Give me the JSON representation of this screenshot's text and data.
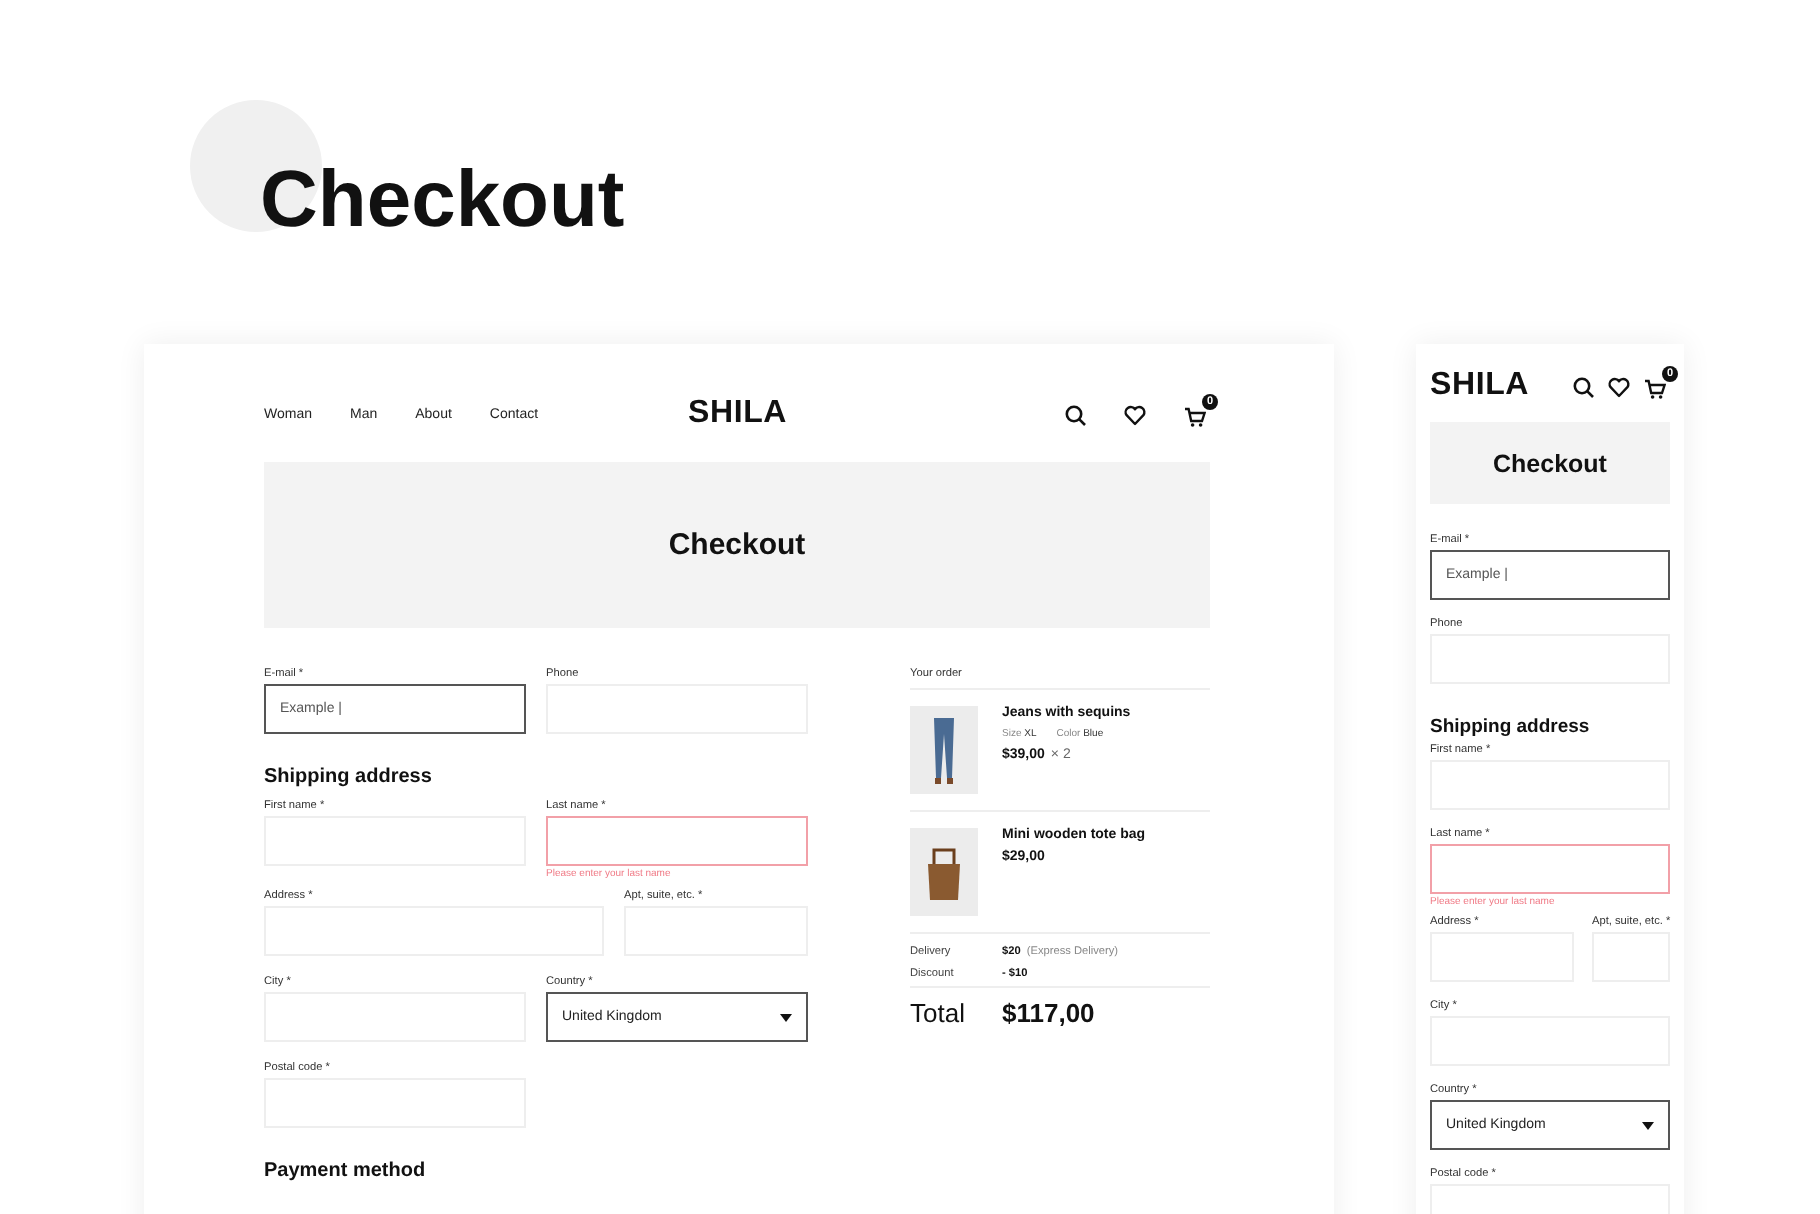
{
  "page_title": "Checkout",
  "desktop": {
    "nav": [
      "Woman",
      "Man",
      "About",
      "Contact"
    ],
    "logo": "SHILA",
    "cart_count": "0",
    "banner": "Checkout",
    "form": [
      {
        "kind": "pair",
        "fields": [
          {
            "label": "E-mail *",
            "value": "Example |",
            "kind": "text",
            "focused": true,
            "invalid": false
          },
          {
            "label": "Phone",
            "kind": "text",
            "focused": false,
            "invalid": false
          }
        ]
      },
      {
        "kind": "heading",
        "text": "Shipping address"
      },
      {
        "kind": "pair",
        "fields": [
          {
            "label": "First name *",
            "kind": "text",
            "focused": false,
            "invalid": false
          },
          {
            "label": "Last name *",
            "kind": "text",
            "focused": false,
            "invalid": true,
            "error": "Please enter your last name"
          }
        ]
      },
      {
        "kind": "address",
        "fields": [
          {
            "label": "Address *",
            "kind": "text",
            "focused": false,
            "invalid": false
          },
          {
            "label": "Apt, suite, etc. *",
            "kind": "text",
            "focused": false,
            "invalid": false
          }
        ]
      },
      {
        "kind": "pair",
        "fields": [
          {
            "label": "City *",
            "kind": "text",
            "focused": false,
            "invalid": false
          },
          {
            "label": "Country *",
            "value": "United Kingdom",
            "kind": "select",
            "focused": true,
            "invalid": false
          }
        ]
      },
      {
        "kind": "pair",
        "fields": [
          {
            "label": "Postal code *",
            "kind": "text",
            "focused": false,
            "invalid": false
          }
        ]
      },
      {
        "kind": "heading",
        "text": "Payment method"
      }
    ],
    "order": {
      "title": "Your order",
      "items": [
        {
          "kind": "jeans",
          "name": "Jeans with sequins",
          "size_label": "Size",
          "size": "XL",
          "color_label": "Color",
          "color_name": "Blue",
          "price": "$39,00",
          "quantity": "× 2"
        },
        {
          "kind": "bag",
          "name": "Mini wooden tote bag",
          "price": "$29,00"
        }
      ],
      "summary": [
        {
          "label": "Delivery",
          "value": "$20",
          "note": "(Express Delivery)"
        },
        {
          "label": "Discount",
          "value": "- $10"
        }
      ],
      "total_label": "Total",
      "total": "$117,00"
    }
  },
  "mobile": {
    "logo": "SHILA",
    "cart_count": "0",
    "banner": "Checkout",
    "form": [
      {
        "kind": "single",
        "fields": [
          {
            "label": "E-mail *",
            "value": "Example |",
            "kind": "text",
            "focused": true,
            "invalid": false
          }
        ]
      },
      {
        "kind": "single",
        "fields": [
          {
            "label": "Phone",
            "kind": "text",
            "focused": false,
            "invalid": false
          }
        ]
      },
      {
        "kind": "heading",
        "text": "Shipping address"
      },
      {
        "kind": "single",
        "fields": [
          {
            "label": "First name *",
            "kind": "text",
            "focused": false,
            "invalid": false
          }
        ]
      },
      {
        "kind": "single",
        "fields": [
          {
            "label": "Last name *",
            "kind": "text",
            "focused": false,
            "invalid": true,
            "error": "Please enter your last name"
          }
        ]
      },
      {
        "kind": "pair",
        "fields": [
          {
            "label": "Address *",
            "kind": "text",
            "focused": false,
            "invalid": false
          },
          {
            "label": "Apt, suite, etc. *",
            "kind": "text",
            "focused": false,
            "invalid": false
          }
        ]
      },
      {
        "kind": "single",
        "fields": [
          {
            "label": "City *",
            "kind": "text",
            "focused": false,
            "invalid": false
          }
        ]
      },
      {
        "kind": "single",
        "fields": [
          {
            "label": "Country *",
            "value": "United Kingdom",
            "kind": "select",
            "focused": true,
            "invalid": false
          }
        ]
      },
      {
        "kind": "single",
        "fields": [
          {
            "label": "Postal code *",
            "kind": "text",
            "focused": false,
            "invalid": false
          }
        ]
      }
    ]
  }
}
